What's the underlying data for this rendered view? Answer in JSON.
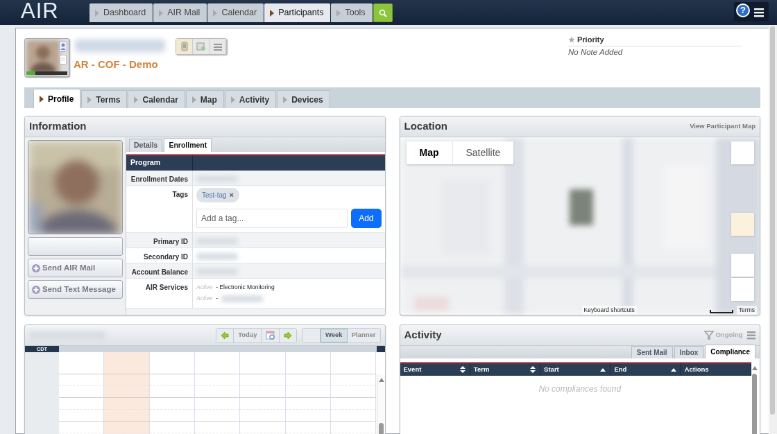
{
  "nav": {
    "logo": "AIR",
    "tabs": [
      {
        "label": "Dashboard",
        "selected": false
      },
      {
        "label": "AIR Mail",
        "selected": false
      },
      {
        "label": "Calendar",
        "selected": false
      },
      {
        "label": "Participants",
        "selected": true
      },
      {
        "label": "Tools",
        "selected": false
      }
    ],
    "help": "?"
  },
  "participant": {
    "program": "AR - COF - Demo",
    "status_bar": {
      "level": 0.22
    },
    "priority": "Priority",
    "note": "No Note Added"
  },
  "profile_tabs": [
    {
      "label": "Profile",
      "selected": true
    },
    {
      "label": "Terms",
      "selected": false
    },
    {
      "label": "Calendar",
      "selected": false
    },
    {
      "label": "Map",
      "selected": false
    },
    {
      "label": "Activity",
      "selected": false
    },
    {
      "label": "Devices",
      "selected": false
    }
  ],
  "information": {
    "title": "Information",
    "actions": [
      "Send AIR Mail",
      "Send Text Message"
    ],
    "tabs": [
      {
        "label": "Details",
        "selected": false
      },
      {
        "label": "Enrollment",
        "selected": true
      }
    ],
    "header": "Program",
    "rows": [
      {
        "label": "Enrollment Dates",
        "kind": "redacted"
      },
      {
        "label": "Tags",
        "kind": "tags",
        "tags": [
          "Test-tag"
        ],
        "remove": "×",
        "placeholder": "Add a tag...",
        "button": "Add"
      },
      {
        "label": "Primary ID",
        "kind": "redacted"
      },
      {
        "label": "Secondary ID",
        "kind": "redacted"
      },
      {
        "label": "Account Balance",
        "kind": "redacted"
      },
      {
        "label": "AIR Services",
        "kind": "services",
        "services": [
          {
            "status": "Active",
            "detail": "- Electronic Monitoring",
            "redacted": false
          },
          {
            "status": "Active",
            "detail": "-",
            "redacted": true
          }
        ]
      }
    ]
  },
  "location": {
    "title": "Location",
    "link": "View Participant Map",
    "map_types": [
      {
        "label": "Map",
        "selected": true
      },
      {
        "label": "Satellite",
        "selected": false
      }
    ],
    "shortcuts": "Keyboard shortcuts",
    "terms": "Terms"
  },
  "calendar": {
    "today": "Today",
    "views": [
      {
        "label": "Week",
        "selected": true
      },
      {
        "label": "Planner",
        "selected": false
      }
    ],
    "timezone": "CDT",
    "days": [
      {
        "today": false
      },
      {
        "today": true
      },
      {
        "today": false
      },
      {
        "today": false
      },
      {
        "today": false
      },
      {
        "today": false
      },
      {
        "today": false
      }
    ]
  },
  "activity": {
    "title": "Activity",
    "filter": "Ongoing",
    "tabs": [
      {
        "label": "Sent Mail",
        "selected": false
      },
      {
        "label": "Inbox",
        "selected": false
      },
      {
        "label": "Compliance",
        "selected": true
      }
    ],
    "columns": [
      {
        "label": "Event",
        "sortable": true,
        "ascending": false
      },
      {
        "label": "Term",
        "sortable": true,
        "ascending": false
      },
      {
        "label": "Start",
        "sortable": true,
        "ascending": true
      },
      {
        "label": "End",
        "sortable": true,
        "ascending": true
      },
      {
        "label": "Actions",
        "sortable": false
      }
    ],
    "empty": "No compliances found"
  }
}
